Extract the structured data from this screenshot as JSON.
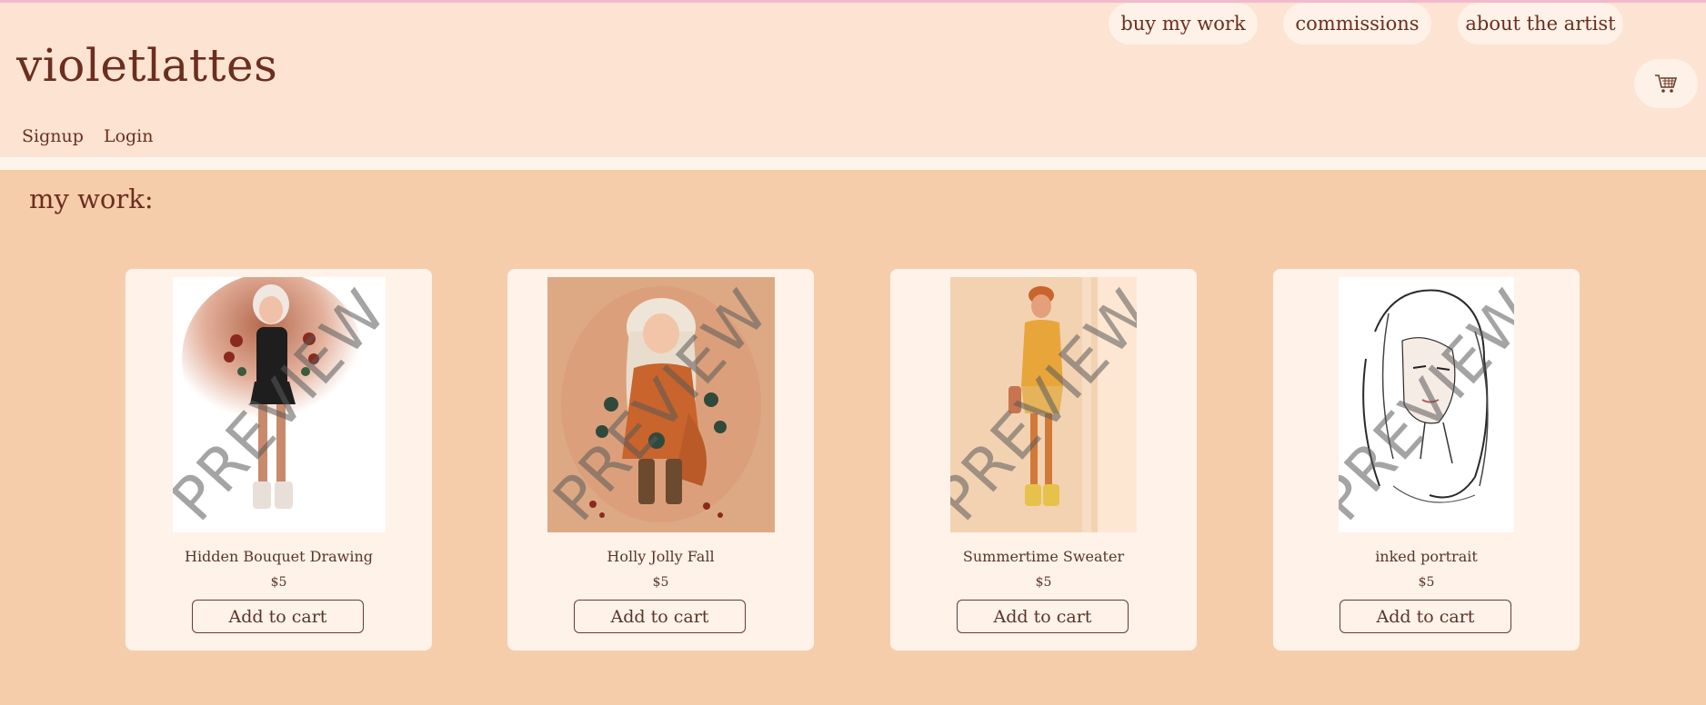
{
  "brand": "violetlattes",
  "auth": {
    "signup": "Signup",
    "login": "Login"
  },
  "nav": [
    {
      "label": "buy my work"
    },
    {
      "label": "commissions"
    },
    {
      "label": "about the artist"
    }
  ],
  "cart_icon": "shopping-cart-icon",
  "section_title": "my work:",
  "watermark": "PREVIEW",
  "products": [
    {
      "name": "Hidden Bouquet Drawing",
      "price": "$5",
      "button": "Add to cart"
    },
    {
      "name": "Holly Jolly Fall",
      "price": "$5",
      "button": "Add to cart"
    },
    {
      "name": "Summertime Sweater",
      "price": "$5",
      "button": "Add to cart"
    },
    {
      "name": "inked portrait",
      "price": "$5",
      "button": "Add to cart"
    }
  ],
  "colors": {
    "header_bg": "#fde3d2",
    "page_bg": "#f6cdab",
    "card_bg": "#fef2e9",
    "text": "#6b2e1f"
  }
}
